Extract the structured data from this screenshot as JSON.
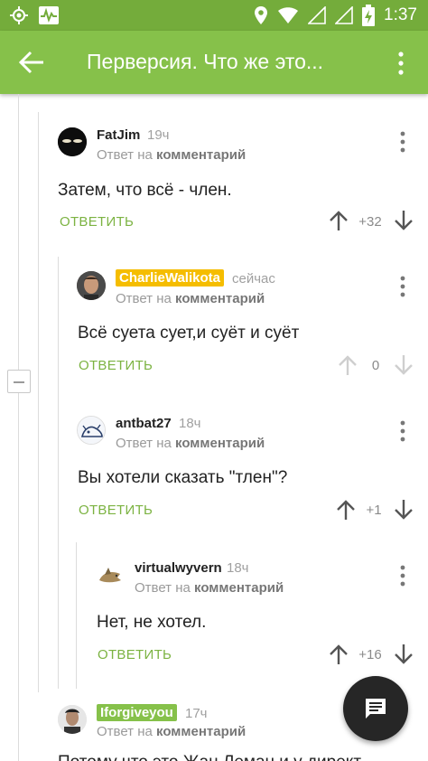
{
  "status_bar": {
    "time": "1:37",
    "icons": [
      "location-target-icon",
      "activity-monitor-icon",
      "location-pin-icon",
      "wifi-icon",
      "signal-icon",
      "battery-charging-icon"
    ]
  },
  "app_bar": {
    "title": "Перверсия. Что же это...",
    "back_icon": "arrow-left-icon",
    "menu_icon": "more-vertical-icon"
  },
  "comments": [
    {
      "author": "FatJim",
      "time": "19ч",
      "reply_prefix": "Ответ на",
      "reply_target": "комментарий",
      "text": "Затем, что всё - член.",
      "reply_label": "ОТВЕТИТЬ",
      "score": "+32"
    },
    {
      "author": "CharlieWalikota",
      "author_badge_color": "#f5bd00",
      "time": "сейчас",
      "reply_prefix": "Ответ на",
      "reply_target": "комментарий",
      "text": "Всё суета сует,и суёт и суёт",
      "reply_label": "ОТВЕТИТЬ",
      "score": "0"
    },
    {
      "author": "antbat27",
      "time": "18ч",
      "reply_prefix": "Ответ на",
      "reply_target": "комментарий",
      "text": "Вы хотели сказать \"тлен\"?",
      "reply_label": "ОТВЕТИТЬ",
      "score": "+1"
    },
    {
      "author": "virtualwyvern",
      "time": "18ч",
      "reply_prefix": "Ответ на",
      "reply_target": "комментарий",
      "text": "Нет, не хотел.",
      "reply_label": "ОТВЕТИТЬ",
      "score": "+16"
    },
    {
      "author": "Iforgiveyou",
      "author_badge_color": "#86c14a",
      "time": "17ч",
      "reply_prefix": "Ответ на",
      "reply_target": "комментарий",
      "text": "Потому что это Жан Леман и у директ..."
    }
  ],
  "fab": {
    "icon": "comment-icon"
  },
  "colors": {
    "accent": "#86c14a",
    "status_bar": "#74ac3b",
    "reply_button": "#7cb342"
  }
}
